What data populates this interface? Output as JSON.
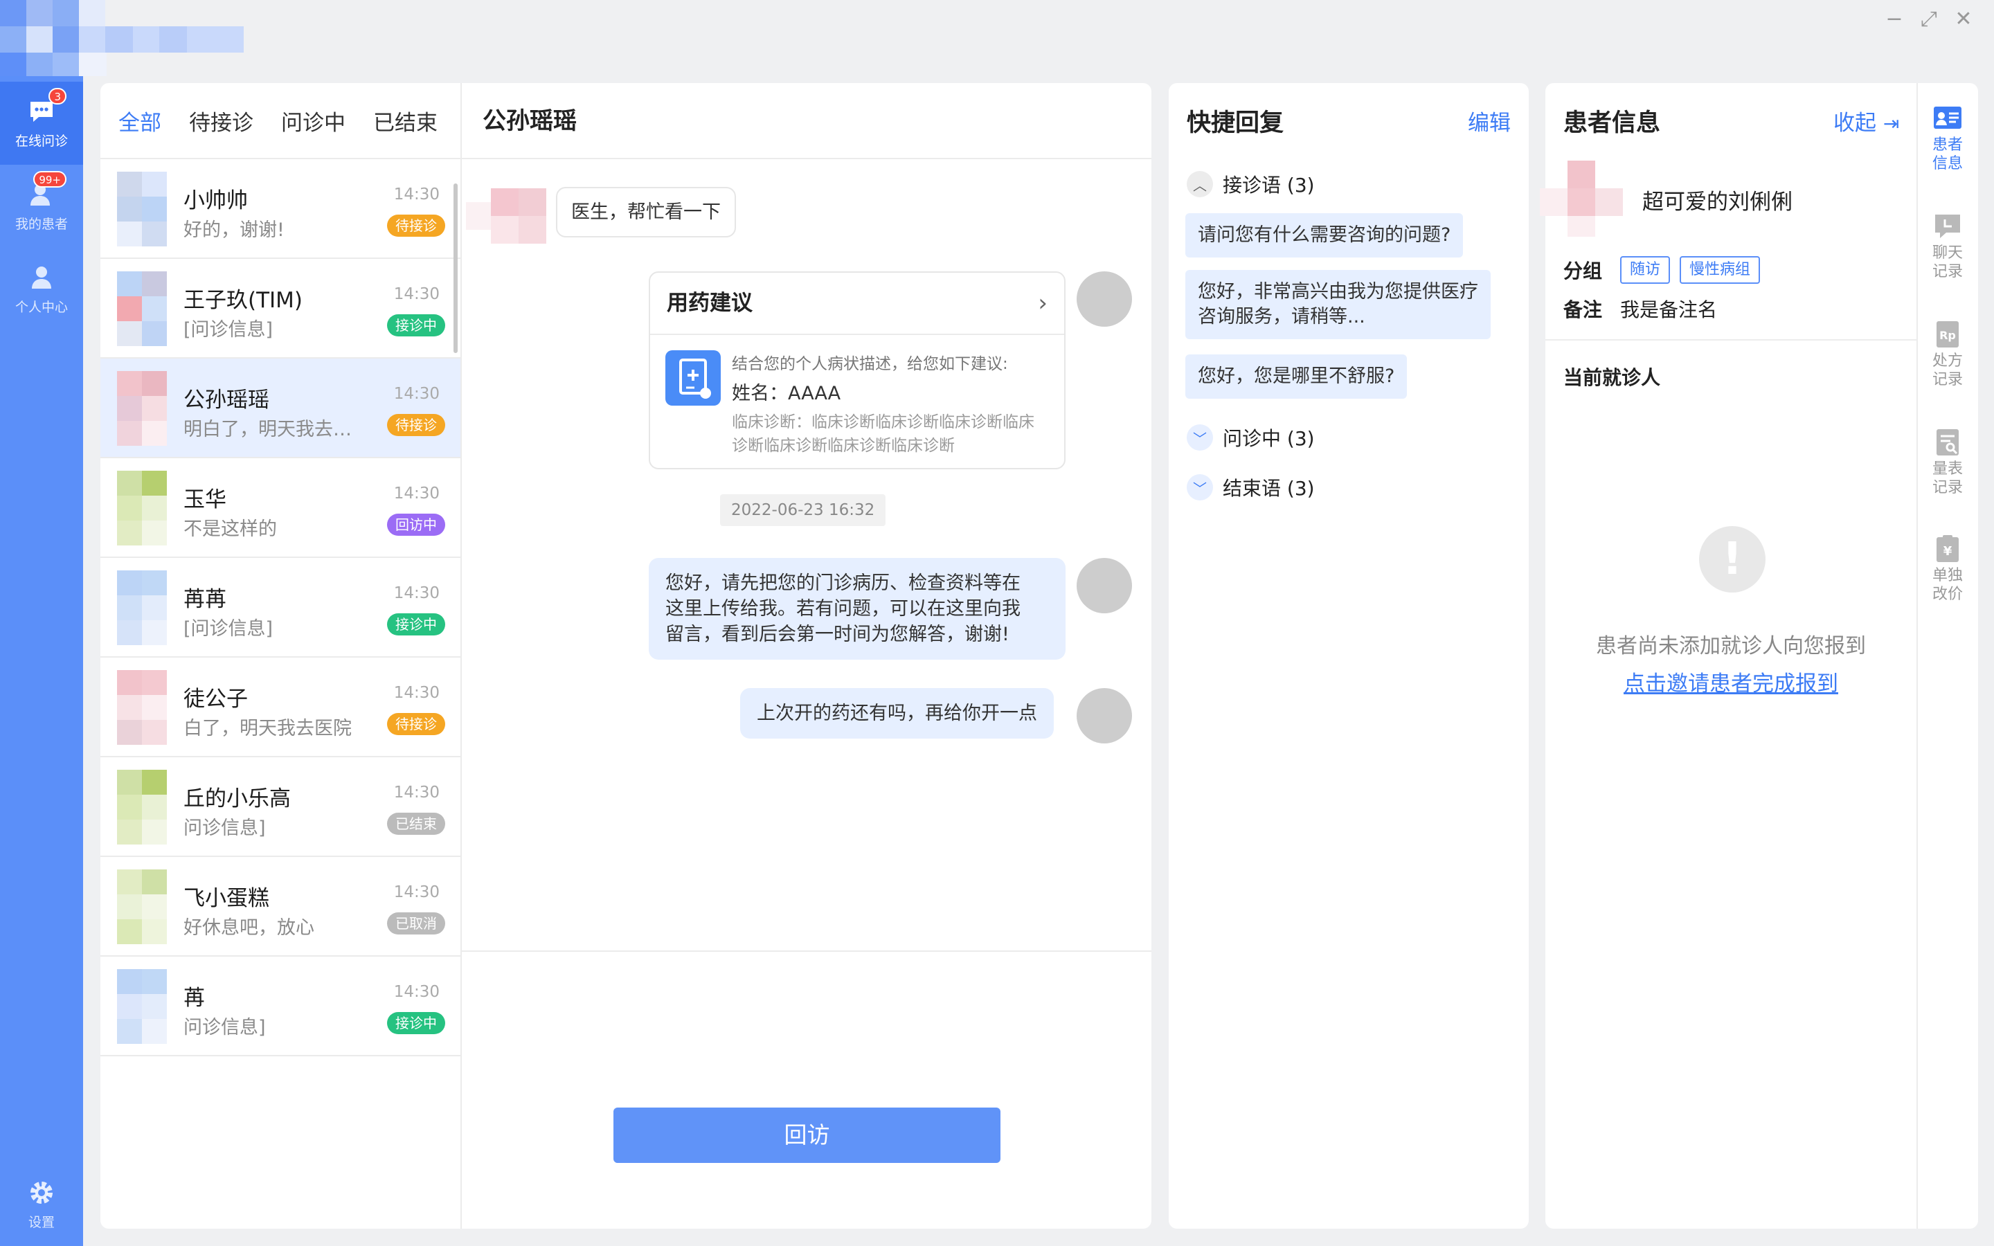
{
  "sidebar": {
    "items": [
      {
        "label": "在线问诊",
        "badge": "3",
        "icon": "chat-bubble-icon"
      },
      {
        "label": "我的患者",
        "badge": "99+",
        "icon": "patients-icon"
      },
      {
        "label": "个人中心",
        "icon": "person-icon"
      }
    ],
    "settings_label": "设置",
    "colors": {
      "bar": "#5b8ff9",
      "active": "#3f78f2"
    }
  },
  "tabs": [
    "全部",
    "待接诊",
    "问诊中",
    "已结束"
  ],
  "conversations": [
    {
      "name": "小帅帅",
      "msg": "好的，谢谢!",
      "time": "14:30",
      "status": "待接诊",
      "color": "#f5a623"
    },
    {
      "name": "王子玖(TIM)",
      "msg": "[问诊信息]",
      "time": "14:30",
      "status": "接诊中",
      "color": "#26c281"
    },
    {
      "name": "公孙瑶瑶",
      "msg": "明白了，明天我去医院",
      "time": "14:30",
      "status": "待接诊",
      "color": "#f5a623"
    },
    {
      "name": "玉华",
      "msg": "不是这样的",
      "time": "14:30",
      "status": "回访中",
      "color": "#9b6cf5"
    },
    {
      "name": "苒苒",
      "msg": "[问诊信息]",
      "time": "14:30",
      "status": "接诊中",
      "color": "#26c281"
    },
    {
      "name": "徒公子",
      "msg": "白了，明天我去医院",
      "time": "14:30",
      "status": "待接诊",
      "color": "#f5a623"
    },
    {
      "name": "丘的小乐高",
      "msg": "问诊信息]",
      "time": "14:30",
      "status": "已结束",
      "color": "#bbbbbb"
    },
    {
      "name": "飞小蛋糕",
      "msg": "好休息吧，放心",
      "time": "14:30",
      "status": "已取消",
      "color": "#bbbbbb"
    },
    {
      "name": "苒",
      "msg": "问诊信息]",
      "time": "14:30",
      "status": "接诊中",
      "color": "#26c281"
    }
  ],
  "chat": {
    "title": "公孙瑶瑶",
    "patient_msg": "医生，帮忙看一下",
    "card": {
      "title": "用药建议",
      "intro": "结合您的个人病状描述，给您如下建议:",
      "name_line": "姓名：AAAA",
      "diag_line1": "临床诊断：临床诊断临床诊断临床诊断临床",
      "diag_line2": "诊断临床诊断临床诊断临床诊断"
    },
    "timestamp": "2022-06-23  16:32",
    "doctor_msg_1": "您好，请先把您的门诊病历、检查资料等在",
    "doctor_msg_2": "这里上传给我。若有问题，可以在这里向我",
    "doctor_msg_3": "留言，看到后会第一时间为您解答，谢谢!",
    "doctor_msg_b": "上次开的药还有吗，再给你开一点",
    "revisit_label": "回访"
  },
  "quick_reply": {
    "title": "快捷回复",
    "edit_label": "编辑",
    "groups": [
      {
        "label": "接诊语 (3)",
        "expanded": true
      },
      {
        "label": "问诊中 (3)",
        "expanded": false
      },
      {
        "label": "结束语 (3)",
        "expanded": false
      }
    ],
    "replies": [
      "请问您有什么需要咨询的问题?",
      "您好，非常高兴由我为您提供医疗",
      "咨询服务，请稍等...",
      "您好，您是哪里不舒服?"
    ]
  },
  "patient": {
    "title": "患者信息",
    "collapse_label": "收起",
    "name": "超可爱的刘俐俐",
    "group_key": "分组",
    "groups": [
      "随访",
      "慢性病组"
    ],
    "note_key": "备注",
    "note": "我是备注名",
    "current_label": "当前就诊人",
    "empty_text": "患者尚未添加就诊人向您报到",
    "invite_link": "点击邀请患者完成报到"
  },
  "tools": [
    {
      "label": "患者信息",
      "l1": "患者",
      "l2": "信息",
      "icon": "patient-card-icon"
    },
    {
      "label": "聊天记录",
      "l1": "聊天",
      "l2": "记录",
      "icon": "chat-record-icon"
    },
    {
      "label": "处方记录",
      "l1": "处方",
      "l2": "记录",
      "icon": "prescription-icon"
    },
    {
      "label": "量表记录",
      "l1": "量表",
      "l2": "记录",
      "icon": "scale-record-icon"
    },
    {
      "label": "单独改价",
      "l1": "单独",
      "l2": "改价",
      "icon": "price-tag-icon"
    }
  ]
}
